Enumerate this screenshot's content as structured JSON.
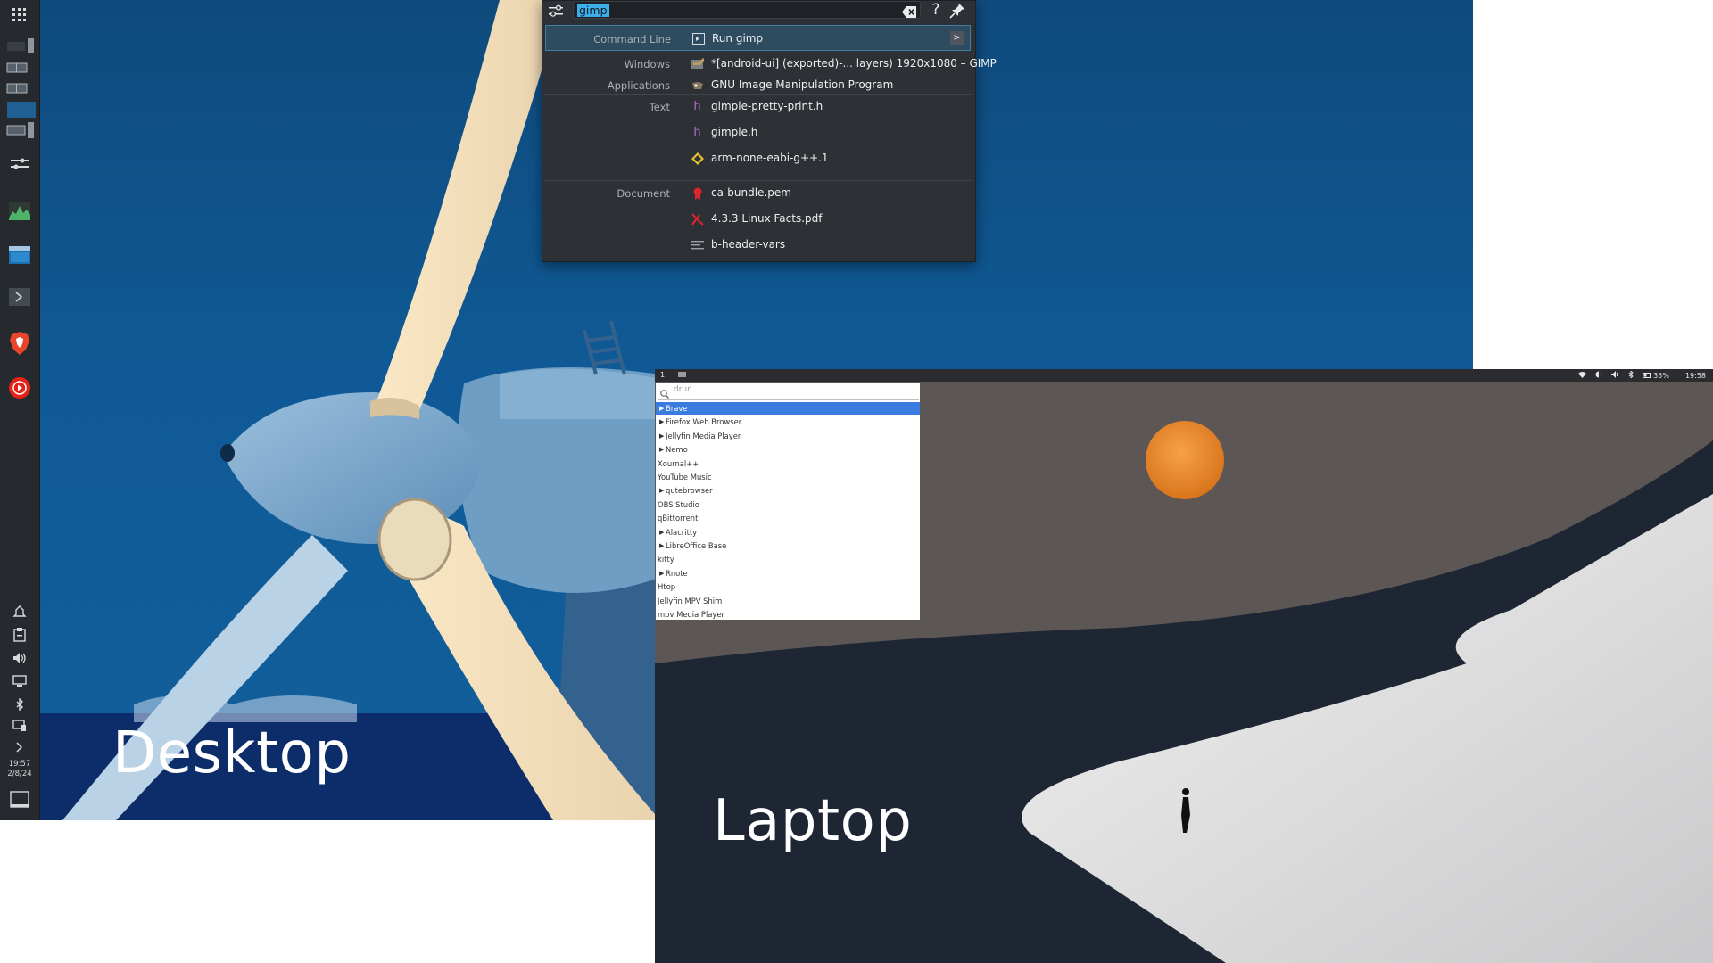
{
  "desktop": {
    "caption": "Desktop",
    "clock": {
      "time": "19:57",
      "date": "2/8/24"
    },
    "side_panel": {
      "icons": [
        "app-grid-icon",
        "layout-icon",
        "layout-icon",
        "layout-icon",
        "layout-icon",
        "layout-icon",
        "settings-sliders-icon",
        "system-monitor-icon",
        "window-icon",
        "terminal-icon",
        "brave-icon",
        "youtube-music-icon"
      ],
      "tray": [
        "notification-icon",
        "clipboard-icon",
        "volume-icon",
        "display-icon",
        "bluetooth-icon",
        "kde-connect-icon",
        "expand-icon",
        "show-desktop-icon"
      ]
    }
  },
  "krunner": {
    "query": "gimp",
    "results": [
      {
        "category": "Command Line",
        "icon": "terminal-icon",
        "text": "Run gimp"
      },
      {
        "category": "Windows",
        "icon": "gimp-icon",
        "text": "*[android-ui] (exported)-... layers) 1920x1080 – GIMP"
      },
      {
        "category": "Applications",
        "icon": "gimp-icon",
        "text": "GNU Image Manipulation Program"
      },
      {
        "category": "Text",
        "icon": "h-file-icon",
        "text": "gimple-pretty-print.h"
      },
      {
        "category": "",
        "icon": "h-file-icon",
        "text": "gimple.h"
      },
      {
        "category": "",
        "icon": "man-page-icon",
        "text": "arm-none-eabi-g++.1"
      },
      {
        "category": "Document",
        "icon": "certificate-icon",
        "text": "ca-bundle.pem"
      },
      {
        "category": "",
        "icon": "pdf-icon",
        "text": "4.3.3 Linux Facts.pdf"
      },
      {
        "category": "",
        "icon": "text-file-icon",
        "text": "b-header-vars"
      }
    ]
  },
  "laptop": {
    "caption": "Laptop",
    "bar": {
      "workspace": "1",
      "battery": "35%",
      "time": "19:58"
    },
    "drun": {
      "placeholder": "drun",
      "items": [
        {
          "label": "Brave",
          "arrow": true
        },
        {
          "label": "Firefox Web Browser",
          "arrow": true
        },
        {
          "label": "Jellyfin Media Player",
          "arrow": true
        },
        {
          "label": "Nemo",
          "arrow": true
        },
        {
          "label": "Xournal++",
          "arrow": false
        },
        {
          "label": "YouTube Music",
          "arrow": false
        },
        {
          "label": "qutebrowser",
          "arrow": true
        },
        {
          "label": "OBS Studio",
          "arrow": false
        },
        {
          "label": "qBittorrent",
          "arrow": false
        },
        {
          "label": "Alacritty",
          "arrow": true
        },
        {
          "label": "LibreOffice Base",
          "arrow": true
        },
        {
          "label": "kitty",
          "arrow": false
        },
        {
          "label": "Rnote",
          "arrow": true
        },
        {
          "label": "Htop",
          "arrow": false
        },
        {
          "label": "Jellyfin MPV Shim",
          "arrow": false
        },
        {
          "label": "mpv Media Player",
          "arrow": false
        }
      ]
    }
  },
  "colors": {
    "desktop_sky": "#0f5a96",
    "krunner_bg": "#2d3136",
    "krunner_selection": "#3daee9",
    "drun_selected": "#3a7be0",
    "moon": "#e8892c"
  }
}
